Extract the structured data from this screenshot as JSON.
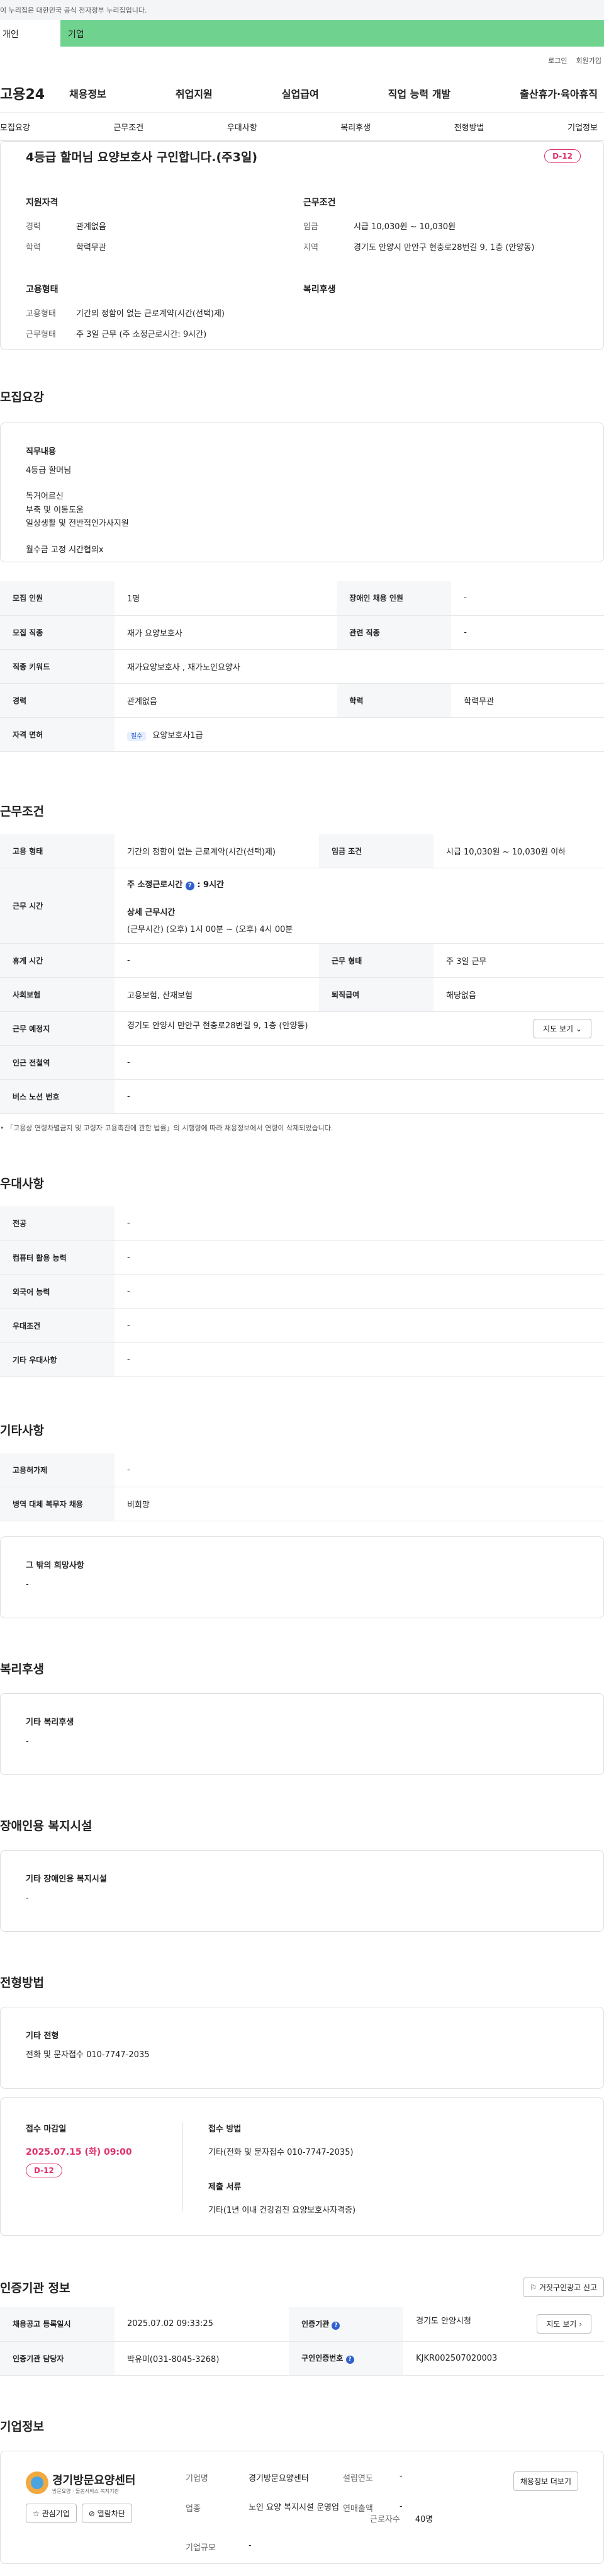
{
  "gov_banner": "이 누리집은 대한민국 공식 전자정부 누리집입니다.",
  "user_tabs": [
    "개인",
    "기업"
  ],
  "util": [
    "로그인",
    "회원가입"
  ],
  "logo": "고용24",
  "gnb": [
    "채용정보",
    "취업지원",
    "실업급여",
    "직업 능력 개발",
    "출산휴가·육아휴직"
  ],
  "subnav": [
    "모집요강",
    "근무조건",
    "우대사항",
    "복리후생",
    "전형방법",
    "기업정보"
  ],
  "summary": {
    "title": "4등급 할머님 요양보호사 구인합니다.(주3일)",
    "dday": "D-12",
    "qual_title": "지원자격",
    "cond_title": "근무조건",
    "career_k": "경력",
    "career_v": "관계없음",
    "edu_k": "학력",
    "edu_v": "학력무관",
    "wage_k": "임금",
    "wage_v": "시급 10,030원 ~ 10,030원",
    "loc_k": "지역",
    "loc_v": "경기도 안양시 만안구 현충로28번길 9, 1층 (안양동)",
    "emp_title": "고용형태",
    "welfare_title": "복리후생",
    "emptype_k": "고용형태",
    "emptype_v": "기간의 정함이 없는 근로계약(시간(선택)제)",
    "worktype_k": "근무형태",
    "worktype_v": "주 3일 근무 (주 소정근로시간: 9시간)"
  },
  "recruit": {
    "title": "모집요강",
    "job_label": "직무내용",
    "job_text": [
      "4등급 할머님",
      "",
      "독거어르신",
      "부축 및 이동도움",
      "일상생활 및 전반적인가사지원",
      "",
      "월수금 고정 시간협의x"
    ],
    "rows": [
      {
        "k1": "모집 인원",
        "v1": "1명",
        "k2": "장애인 채용 인원",
        "v2": "-"
      },
      {
        "k1": "모집 직종",
        "v1": "재가 요양보호사",
        "k2": "관련 직종",
        "v2": "-"
      },
      {
        "k1": "직종 키워드",
        "v1": "재가요양보호사 , 재가노인요양사"
      },
      {
        "k1": "경력",
        "v1": "관계없음",
        "k2": "학력",
        "v2": "학력무관"
      },
      {
        "k1": "자격 면허",
        "v1": "요양보호사1급",
        "badge": "필수"
      }
    ]
  },
  "work": {
    "title": "근무조건",
    "emptype_k": "고용 형태",
    "emptype_v": "기간의 정함이 없는 근로계약(시간(선택)제)",
    "wage_k": "임금 조건",
    "wage_v": "시급 10,030원 ~ 10,030원 이하",
    "time_k": "근무 시간",
    "time_week": "주 소정근로시간",
    "time_week_v": ": 9시간",
    "time_detail": "상세 근무시간",
    "time_detail_v": "(근무시간) (오후) 1시 00분 ~ (오후) 4시 00분",
    "rest_k": "휴게 시간",
    "rest_v": "-",
    "shape_k": "근무 형태",
    "shape_v": "주 3일 근무",
    "ins_k": "사회보험",
    "ins_v": "고용보험, 산재보험",
    "retire_k": "퇴직급여",
    "retire_v": "해당없음",
    "place_k": "근무 예정지",
    "place_v": "경기도 안양시 만안구 현충로28번길 9, 1층 (안양동)",
    "map_btn": "지도 보기",
    "subway_k": "인근 전철역",
    "subway_v": "-",
    "bus_k": "버스 노선 번호",
    "bus_v": "-",
    "note": "「고용상 연령차별금지 및 고령자 고용촉진에 관한 법률」의 시행령에 따라 채용정보에서 연령이 삭제되었습니다."
  },
  "prefer": {
    "title": "우대사항",
    "rows": [
      [
        "전공",
        "-"
      ],
      [
        "컴퓨터 활용 능력",
        "-"
      ],
      [
        "외국어 능력",
        "-"
      ],
      [
        "우대조건",
        "-"
      ],
      [
        "기타 우대사항",
        "-"
      ]
    ]
  },
  "etc": {
    "title": "기타사항",
    "rows": [
      [
        "고용허가제",
        "-"
      ],
      [
        "병역 대체 복무자 채용",
        "비희망"
      ]
    ],
    "hope_label": "그 밖의 희망사항",
    "hope_v": "-"
  },
  "welfare": {
    "title": "복리후생",
    "label": "기타 복리후생",
    "v": "-"
  },
  "disabled": {
    "title": "장애인용 복지시설",
    "label": "기타 장애인용 복지시설",
    "v": "-"
  },
  "process": {
    "title": "전형방법",
    "label": "기타 전형",
    "v": "전화 및 문자접수 010-7747-2035",
    "deadline_label": "접수 마감일",
    "deadline_v": "2025.07.15 (화) 09:00",
    "dday": "D-12",
    "method_label": "접수 방법",
    "method_v": "기타(전화 및 문자접수 010-7747-2035)",
    "docs_label": "제출 서류",
    "docs_v": "기타(1년 이내 건강검진 요양보호사자격증)"
  },
  "cert": {
    "title": "인증기관 정보",
    "report_btn": "거짓구인광고 신고",
    "reg_k": "채용공고 등록일시",
    "reg_v": "2025.07.02 09:33:25",
    "org_k": "인증기관",
    "org_v": "경기도 안양시청",
    "map_btn": "지도 보기",
    "mgr_k": "인증기관 담당자",
    "mgr_v": "박유미(031-8045-3268)",
    "no_k": "구인인증번호",
    "no_v": "KJKR002507020003"
  },
  "company": {
    "title": "기업정보",
    "logo_text": "경기방문요양센터",
    "logo_sub": "방문요양 · 돌봄서비스 복지기관",
    "interest_btn": "관심기업",
    "block_btn": "열람차단",
    "name_k": "기업명",
    "name_v": "경기방문요양센터",
    "year_k": "설립연도",
    "year_v": "-",
    "job_k": "업종",
    "job_v": "노인 요양 복지시설 운영업",
    "sales_k": "연매출액",
    "sales_v": "-",
    "emp_k": "근로자수",
    "emp_v": "40명",
    "size_k": "기업규모",
    "size_v": "-",
    "list_btn": "채용정보 더보기"
  },
  "accent": "#6fd28e",
  "dday_color": "#e0306a"
}
